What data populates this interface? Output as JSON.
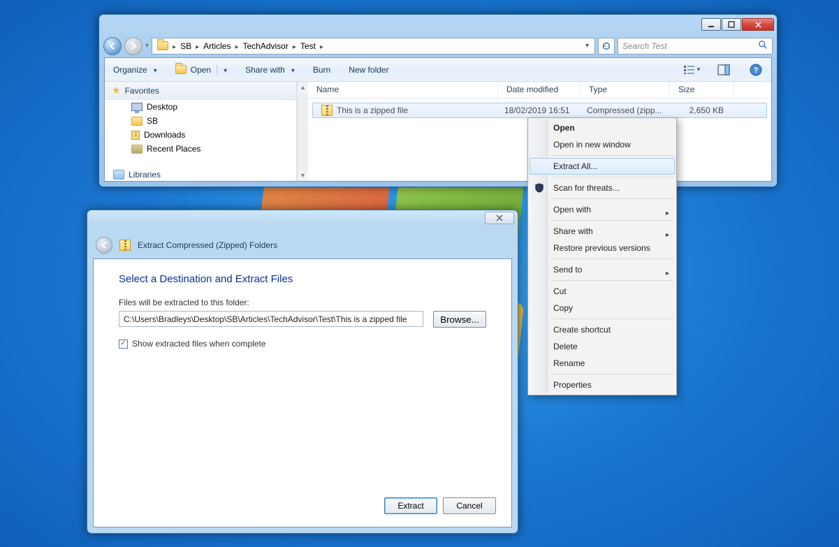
{
  "breadcrumb": [
    "SB",
    "Articles",
    "TechAdvisor",
    "Test"
  ],
  "search": {
    "placeholder": "Search Test"
  },
  "toolbar": {
    "organize": "Organize",
    "open": "Open",
    "share": "Share with",
    "burn": "Burn",
    "newfolder": "New folder"
  },
  "nav": {
    "favorites": "Favorites",
    "items": [
      "Desktop",
      "SB",
      "Downloads",
      "Recent Places"
    ],
    "libraries": "Libraries"
  },
  "columns": {
    "name": "Name",
    "date": "Date modified",
    "type": "Type",
    "size": "Size"
  },
  "file": {
    "name": "This is a zipped file",
    "date": "18/02/2019 16:51",
    "type": "Compressed (zipp...",
    "size": "2,650 KB"
  },
  "contextmenu": {
    "open": "Open",
    "openwin": "Open in new window",
    "extract": "Extract All...",
    "scan": "Scan for threats...",
    "openwith": "Open with",
    "sharewith": "Share with",
    "restore": "Restore previous versions",
    "sendto": "Send to",
    "cut": "Cut",
    "copy": "Copy",
    "shortcut": "Create shortcut",
    "delete": "Delete",
    "rename": "Rename",
    "properties": "Properties"
  },
  "dialog": {
    "windowTitle": "Extract Compressed (Zipped) Folders",
    "heading": "Select a Destination and Extract Files",
    "label": "Files will be extracted to this folder:",
    "path": "C:\\Users\\Bradleys\\Desktop\\SB\\Articles\\TechAdvisor\\Test\\This is a zipped file",
    "browse": "Browse...",
    "checkbox": "Show extracted files when complete",
    "checked": true,
    "extract": "Extract",
    "cancel": "Cancel"
  },
  "colors": {
    "accent": "#003399",
    "selection": "#e3effc"
  }
}
